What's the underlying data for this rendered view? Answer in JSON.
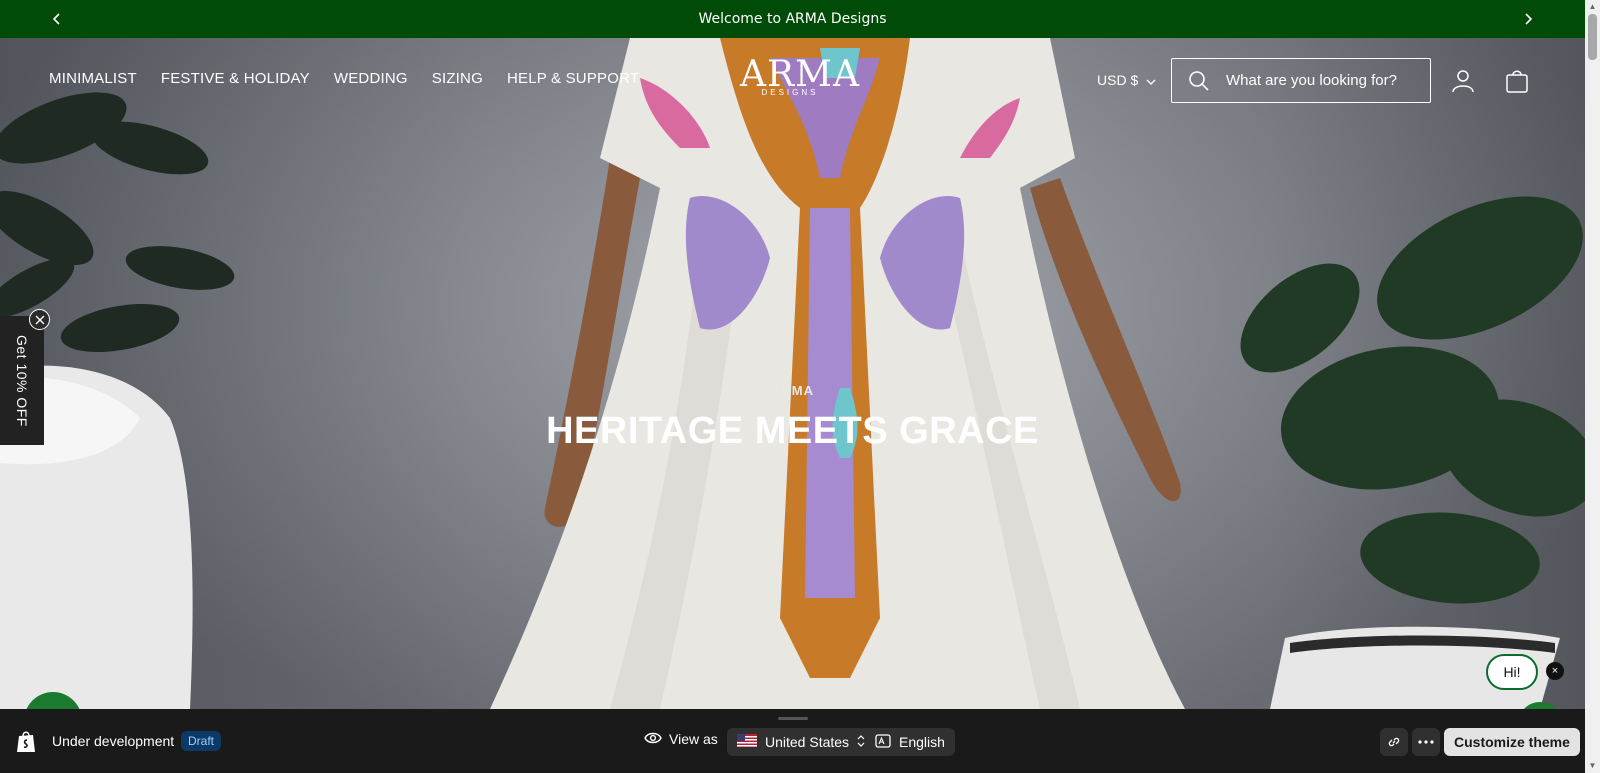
{
  "announcement": {
    "text": "Welcome to ARMA Designs"
  },
  "nav": {
    "items": [
      "MINIMALIST",
      "FESTIVE & HOLIDAY",
      "WEDDING",
      "SIZING",
      "HELP & SUPPORT"
    ]
  },
  "logo": {
    "text": "ARMA",
    "subtext": "DESIGNS"
  },
  "currency": {
    "label": "USD $"
  },
  "search": {
    "placeholder": "What are you looking for?"
  },
  "hero": {
    "eyebrow": "ARMA",
    "title": "HERITAGE MEETS GRACE"
  },
  "promo_tab": {
    "label": "Get 10% OFF"
  },
  "chat": {
    "greeting": "Hi!",
    "close": "×"
  },
  "admin_bar": {
    "status": "Under development",
    "badge": "Draft",
    "view_as": "View as",
    "country": "United States",
    "language": "English",
    "customize": "Customize theme"
  },
  "colors": {
    "announcement_bg": "#004b08",
    "admin_bg": "#1a1a1a",
    "draft_badge": "#0b3a66"
  }
}
